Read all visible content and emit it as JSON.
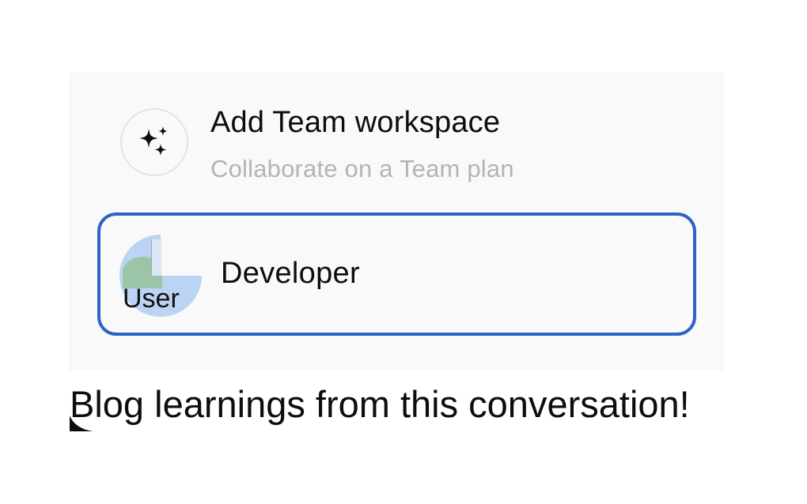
{
  "menu": {
    "add_workspace": {
      "icon": "sparkles-icon",
      "title": "Add Team workspace",
      "subtitle": "Collaborate on a Team plan"
    },
    "developer": {
      "avatar_icon": "user-avatar-broken-image",
      "avatar_alt": "User",
      "label": "Developer",
      "selected": true,
      "highlight_color": "#2b63c8"
    }
  },
  "caption": "Blog learnings from this conversation!"
}
